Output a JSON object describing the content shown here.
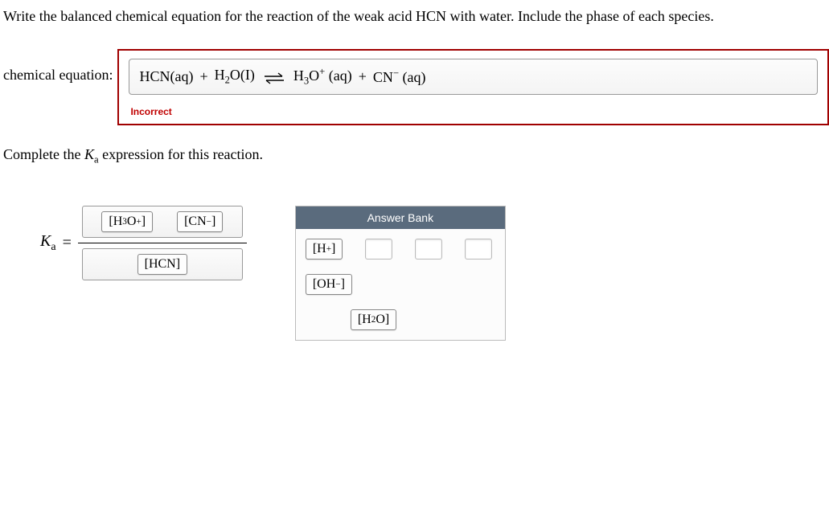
{
  "question": "Write the balanced chemical equation for the reaction of the weak acid HCN with water. Include the phase of each species.",
  "equation_label": "chemical equation:",
  "equation": {
    "term1": "HCN(aq)",
    "plus1": "+",
    "term2_pre": "H",
    "term2_sub": "2",
    "term2_post": "O(I)",
    "term3_pre": "H",
    "term3_sub": "3",
    "term3_post": "O",
    "term3_sup": "+",
    "term3_phase": "(aq)",
    "plus2": "+",
    "term4_pre": "CN",
    "term4_sup": "−",
    "term4_phase": "(aq)"
  },
  "feedback": "Incorrect",
  "subquestion_pre": "Complete the ",
  "subquestion_var": "K",
  "subquestion_varsub": "a",
  "subquestion_post": " expression for this reaction.",
  "ka": {
    "K": "K",
    "a": "a",
    "equals": "="
  },
  "chips": {
    "h3o": {
      "open": "[",
      "pre": "H",
      "sub": "3",
      "mid": "O",
      "sup": "+",
      "close": "]"
    },
    "cn": {
      "open": "[",
      "pre": "CN",
      "sup": "−",
      "close": "]"
    },
    "hcn": {
      "open": "[",
      "pre": "HCN",
      "close": "]"
    },
    "h": {
      "open": "[",
      "pre": "H",
      "sup": "+",
      "close": "]"
    },
    "oh": {
      "open": "[",
      "pre": "OH",
      "sup": "−",
      "close": "]"
    },
    "h2o": {
      "open": "[",
      "pre": "H",
      "sub": "2",
      "mid": "O",
      "close": "]"
    }
  },
  "answer_bank_title": "Answer Bank"
}
